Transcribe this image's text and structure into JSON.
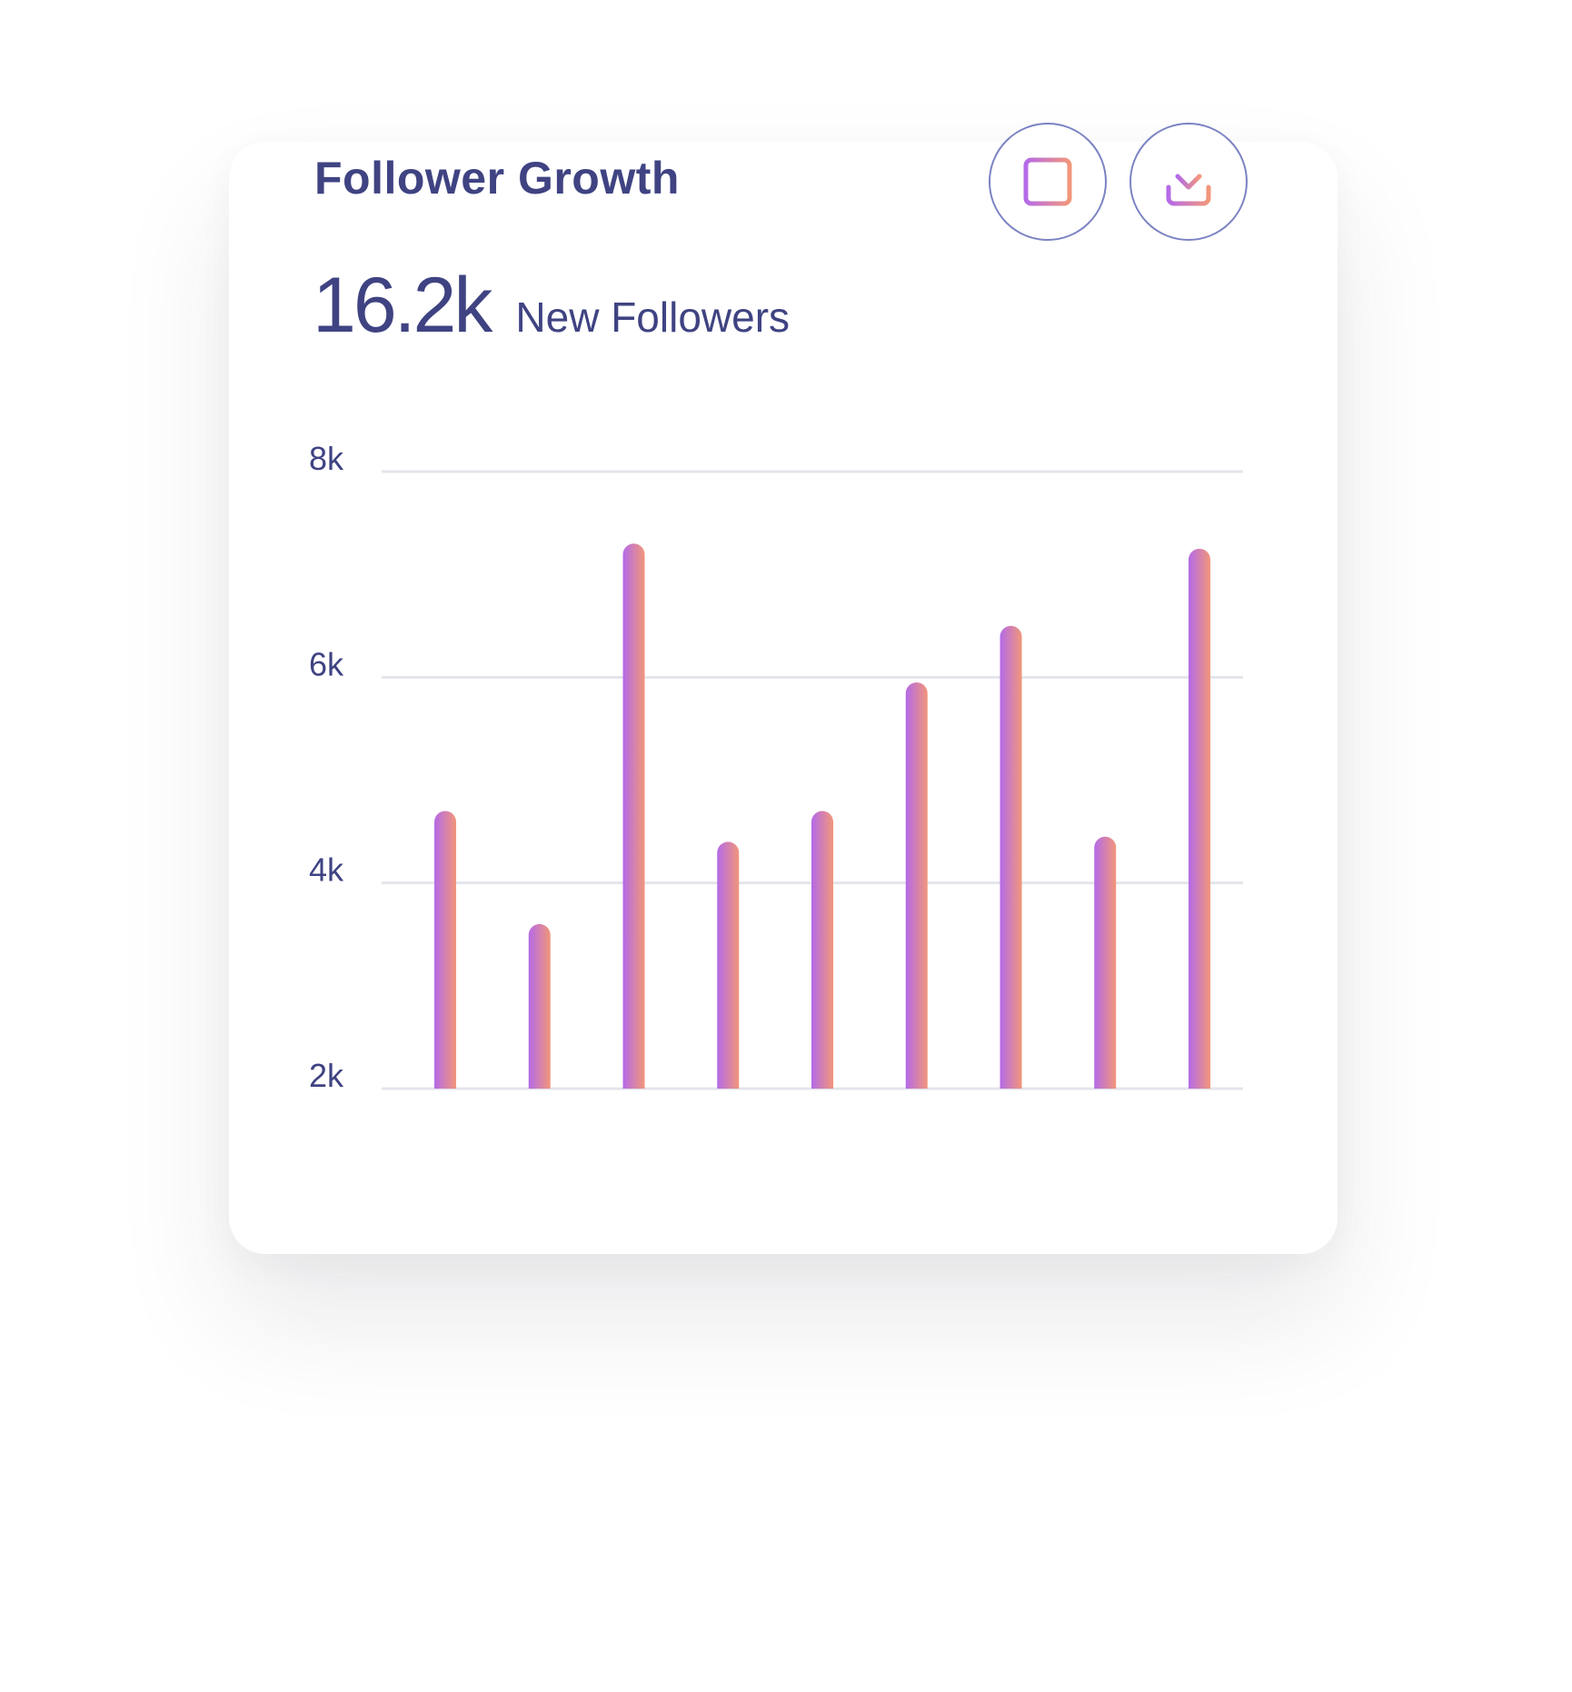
{
  "header": {
    "title": "Follower Growth",
    "table_button_icon": "table-grid-icon",
    "download_button_icon": "download-icon"
  },
  "summary": {
    "value": "16.2k",
    "label": "New Followers"
  },
  "colors": {
    "text": "#3f4382",
    "button_border": "#7b83c2",
    "bar_gradient_start": "#b46ae8",
    "bar_gradient_end": "#f2967a",
    "gridline": "#e4e4ec"
  },
  "chart_data": {
    "type": "bar",
    "title": "",
    "xlabel": "",
    "ylabel": "",
    "ylim": [
      2000,
      8000
    ],
    "y_ticks": [
      {
        "value": 8000,
        "label": "8k"
      },
      {
        "value": 6000,
        "label": "6k"
      },
      {
        "value": 4000,
        "label": "4k"
      },
      {
        "value": 2000,
        "label": "2k"
      }
    ],
    "grid": true,
    "legend": "none",
    "categories": [],
    "values": [
      4700,
      3600,
      7300,
      4400,
      4700,
      5950,
      6500,
      4450,
      7250
    ]
  }
}
